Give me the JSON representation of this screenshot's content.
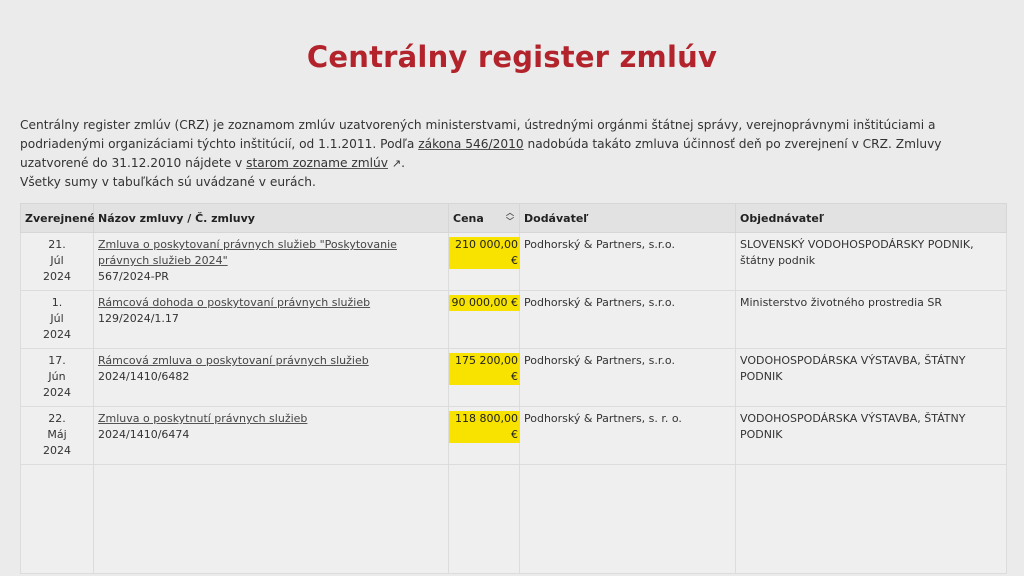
{
  "page": {
    "title": "Centrálny register zmlúv",
    "intro": {
      "part1": "Centrálny register zmlúv (CRZ) je zoznamom zmlúv uzatvorených ministerstvami, ústrednými orgánmi štátnej správy, verejnoprávnymi inštitúciami a podriadenými organizáciami týchto inštitúcií, od 1.1.2011. Podľa ",
      "law_link": "zákona 546/2010",
      "part2": " nadobúda takáto zmluva účinnosť deň po zverejnení v CRZ. Zmluvy uzatvorené do 31.12.2010 nájdete v ",
      "old_list_link": "starom zozname zmlúv",
      "ext_icon": "↗",
      "part3": ".",
      "note": "Všetky sumy v tabuľkách sú uvádzané v eurách."
    }
  },
  "table": {
    "headers": {
      "date": "Zverejnené",
      "name": "Názov zmluvy / Č. zmluvy",
      "price": "Cena",
      "supplier": "Dodávateľ",
      "customer": "Objednávateľ"
    },
    "rows": [
      {
        "day": "21.",
        "month": "Júl",
        "year": "2024",
        "name": "Zmluva o poskytovaní právnych služieb \"Poskytovanie právnych služieb 2024\"",
        "number": "567/2024-PR",
        "price": "210 000,00 €",
        "supplier": "Podhorský & Partners, s.r.o.",
        "customer": "SLOVENSKÝ VODOHOSPODÁRSKY PODNIK, štátny podnik"
      },
      {
        "day": "1.",
        "month": "Júl",
        "year": "2024",
        "name": "Rámcová dohoda o poskytovaní právnych služieb",
        "number": "129/2024/1.17",
        "price": "90 000,00 €",
        "supplier": "Podhorský & Partners, s.r.o.",
        "customer": "Ministerstvo životného prostredia SR"
      },
      {
        "day": "17.",
        "month": "Jún",
        "year": "2024",
        "name": "Rámcová zmluva o poskytovaní právnych služieb",
        "number": "2024/1410/6482",
        "price": "175 200,00 €",
        "supplier": "Podhorský & Partners, s.r.o.",
        "customer": "VODOHOSPODÁRSKA VÝSTAVBA, ŠTÁTNY PODNIK"
      },
      {
        "day": "22.",
        "month": "Máj",
        "year": "2024",
        "name": "Zmluva o poskytnutí právnych služieb",
        "number": "2024/1410/6474",
        "price": "118 800,00 €",
        "supplier": "Podhorský & Partners, s. r. o.",
        "customer": "VODOHOSPODÁRSKA VÝSTAVBA, ŠTÁTNY PODNIK"
      }
    ]
  },
  "icons": {
    "sort": "sort-icon",
    "external": "external-link-icon"
  },
  "colors": {
    "title": "#b3232b",
    "price_highlight": "#f7e200"
  }
}
